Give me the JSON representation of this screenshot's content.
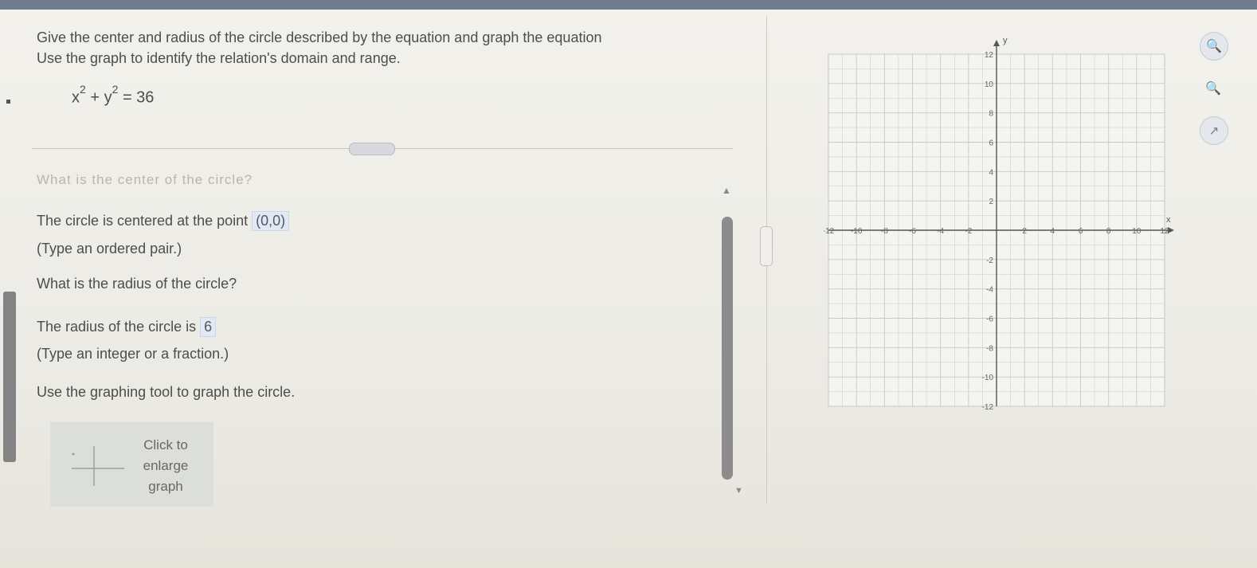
{
  "question": {
    "line1": "Give the center and radius of the circle described by the equation and graph the equation",
    "line2": "Use the graph to identify the relation's domain and range.",
    "equation": {
      "x": "x",
      "exp1": "2",
      "plus": " + ",
      "y": "y",
      "exp2": "2",
      "rhs": " = 36"
    }
  },
  "faded_prompt": "What is the center of the circle?",
  "center": {
    "prefix": "The circle is centered at the point ",
    "answer": "(0,0)",
    "hint": "(Type an ordered pair.)"
  },
  "radius": {
    "question": "What is the radius of the circle?",
    "prefix": "The radius of the circle is ",
    "answer": "6",
    "hint": "(Type an integer or a fraction.)"
  },
  "graph_instruction": "Use the graphing tool to graph the circle.",
  "thumbnail": {
    "label_lines": [
      "Click to",
      "enlarge",
      "graph"
    ]
  },
  "chart_data": {
    "type": "grid",
    "xlabel": "x",
    "ylabel": "y",
    "xlim": [
      -12,
      12
    ],
    "ylim": [
      -12,
      12
    ],
    "grid": true,
    "x_ticks": [
      "-12",
      "-10",
      "-8",
      "-6",
      "-4",
      "-2",
      "2",
      "4",
      "6",
      "8",
      "10",
      "12"
    ],
    "y_ticks": [
      "12",
      "10",
      "8",
      "6",
      "4",
      "2",
      "-2",
      "-4",
      "-6",
      "-8",
      "-10",
      "-12"
    ]
  },
  "tools": [
    "zoom-in-icon",
    "zoom-out-icon",
    "popout-icon"
  ],
  "colors": {
    "grid": "#c8c8c8",
    "axis": "#555555",
    "answer_bg": "#e2e9f3"
  }
}
